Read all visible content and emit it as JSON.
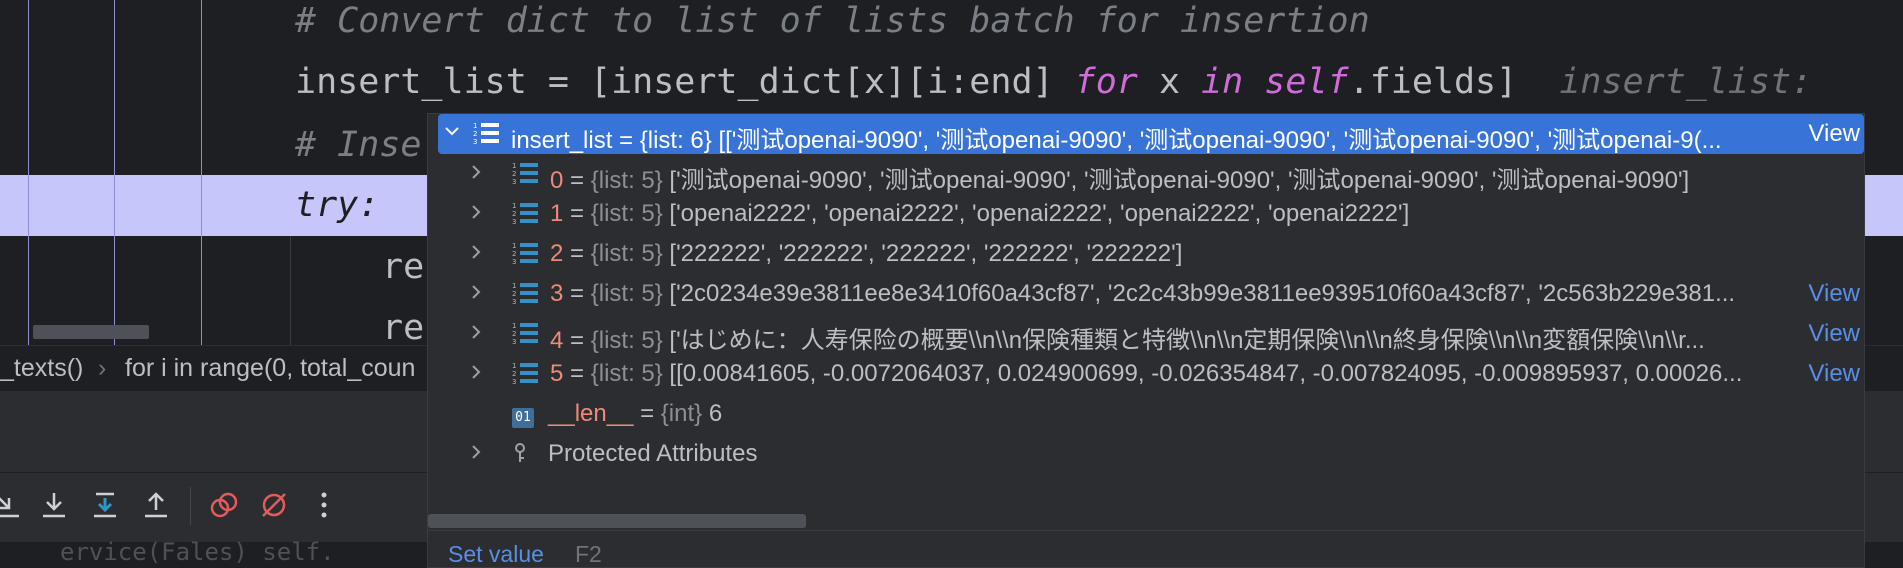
{
  "editor": {
    "line1": "# Convert dict to list of lists batch for insertion",
    "line2_a": "insert_list = [insert_dict[x][i:end] ",
    "line2_for": "for",
    "line2_b": " x ",
    "line2_in": "in",
    "line2_self": "self",
    "line2_c": ".fields]",
    "line2_hint": "insert_list:",
    "line3": "# Inse",
    "line4": "try:",
    "line5": "re",
    "line6": "re"
  },
  "breadcrumb": {
    "item1": "_texts()",
    "separator": "›",
    "item2": "for i in range(0, total_coun"
  },
  "popup": {
    "root": {
      "name": "insert_list",
      "eq": " = ",
      "type": "{list: 6}",
      "value": " [['测试openai-9090', '测试openai-9090', '测试openai-9090', '测试openai-9090', '测试openai-9(...",
      "view": "View"
    },
    "items": [
      {
        "index": "0",
        "type": "{list: 5}",
        "value": " ['测试openai-9090', '测试openai-9090', '测试openai-9090', '测试openai-9090', '测试openai-9090']",
        "view": ""
      },
      {
        "index": "1",
        "type": "{list: 5}",
        "value": " ['openai2222', 'openai2222', 'openai2222', 'openai2222', 'openai2222']",
        "view": ""
      },
      {
        "index": "2",
        "type": "{list: 5}",
        "value": " ['222222', '222222', '222222', '222222', '222222']",
        "view": ""
      },
      {
        "index": "3",
        "type": "{list: 5}",
        "value": " ['2c0234e39e3811ee8e3410f60a43cf87', '2c2c43b99e3811ee939510f60a43cf87', '2c563b229e381...",
        "view": "View"
      },
      {
        "index": "4",
        "type": "{list: 5}",
        "value": " ['はじめに：人寿保险の概要\\\\n\\\\n保険種類と特徴\\\\n\\\\n定期保険\\\\n\\\\n終身保険\\\\n\\\\n変額保険\\\\n\\\\r...",
        "view": "View"
      },
      {
        "index": "5",
        "type": "{list: 5}",
        "value": " [[0.00841605, -0.0072064037, 0.024900699, -0.026354847, -0.007824095, -0.009895937, 0.00026...",
        "view": "View"
      }
    ],
    "len": {
      "icon": "01",
      "name": "__len__",
      "eq": " = ",
      "type": "{int}",
      "value": " 6"
    },
    "protected": "Protected Attributes",
    "footer": {
      "set_value": "Set value",
      "shortcut": "F2"
    },
    "eq": " = "
  },
  "bottom_code": "ervice(Fales)      self.",
  "colors": {
    "selection": "#3874d8",
    "highlight_row": "#c7c6fa",
    "keyword": "#cf6cd9",
    "index": "#ed8a7a",
    "link": "#5a8ee6"
  }
}
